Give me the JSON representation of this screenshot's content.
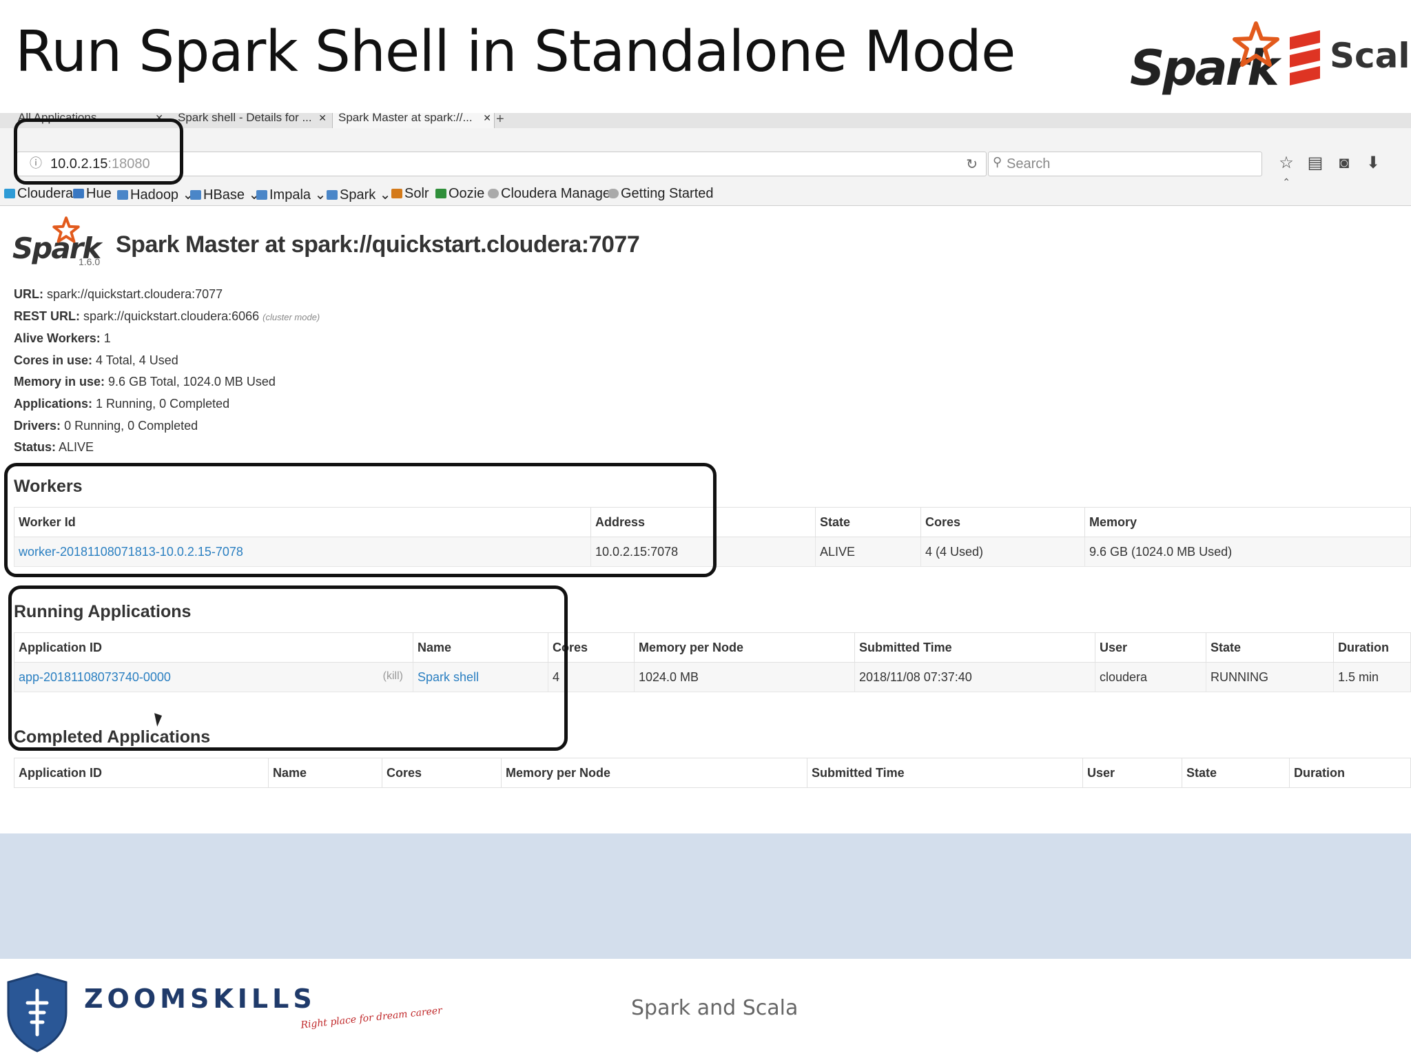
{
  "slide": {
    "title": "Run Spark Shell in Standalone Mode",
    "logos": {
      "spark": "Spark",
      "scala": "Scala"
    },
    "footer": {
      "brand": "ZOOMSKILLS",
      "tagline": "Right place for dream career",
      "center_text": "Spark and Scala"
    }
  },
  "browser": {
    "tabs": [
      {
        "label": "All Applications"
      },
      {
        "label": "Spark shell - Details for ..."
      },
      {
        "label": "Spark Master at spark://..."
      }
    ],
    "address": {
      "host": "10.0.2.15",
      "port": ":18080"
    },
    "search_placeholder": "Search",
    "bookmarks": [
      {
        "label": "Cloudera",
        "color": "#2e9bd6"
      },
      {
        "label": "Hue",
        "color": "#3a78c2"
      },
      {
        "label": "Hadoop",
        "color": "#4a86c8"
      },
      {
        "label": "HBase",
        "color": "#4a86c8"
      },
      {
        "label": "Impala",
        "color": "#4a86c8"
      },
      {
        "label": "Spark",
        "color": "#4a86c8"
      },
      {
        "label": "Solr",
        "color": "#d47a1a"
      },
      {
        "label": "Oozie",
        "color": "#2f8f3a"
      },
      {
        "label": "Cloudera Manager",
        "color": "#aaaaaa"
      },
      {
        "label": "Getting Started",
        "color": "#aaaaaa"
      }
    ]
  },
  "spark_ui": {
    "brand": "Spark",
    "version": "1.6.0",
    "heading": "Spark Master at spark://quickstart.cloudera:7077",
    "info": [
      {
        "key": "URL:",
        "value": "spark://quickstart.cloudera:7077",
        "note": ""
      },
      {
        "key": "REST URL:",
        "value": "spark://quickstart.cloudera:6066",
        "note": "(cluster mode)"
      },
      {
        "key": "Alive Workers:",
        "value": "1",
        "note": ""
      },
      {
        "key": "Cores in use:",
        "value": "4 Total, 4 Used",
        "note": ""
      },
      {
        "key": "Memory in use:",
        "value": "9.6 GB Total, 1024.0 MB Used",
        "note": ""
      },
      {
        "key": "Applications:",
        "value": "1 Running, 0 Completed",
        "note": ""
      },
      {
        "key": "Drivers:",
        "value": "0 Running, 0 Completed",
        "note": ""
      },
      {
        "key": "Status:",
        "value": "ALIVE",
        "note": ""
      }
    ],
    "workers": {
      "title": "Workers",
      "columns": [
        "Worker Id",
        "Address",
        "State",
        "Cores",
        "Memory"
      ],
      "rows": [
        [
          "worker-20181108071813-10.0.2.15-7078",
          "10.0.2.15:7078",
          "ALIVE",
          "4 (4 Used)",
          "9.6 GB (1024.0 MB Used)"
        ]
      ]
    },
    "running": {
      "title": "Running Applications",
      "columns": [
        "Application ID",
        "Name",
        "Cores",
        "Memory per Node",
        "Submitted Time",
        "User",
        "State",
        "Duration"
      ],
      "kill_label": "(kill)",
      "rows": [
        [
          "app-20181108073740-0000",
          "Spark shell",
          "4",
          "1024.0 MB",
          "2018/11/08 07:37:40",
          "cloudera",
          "RUNNING",
          "1.5 min"
        ]
      ]
    },
    "completed": {
      "title": "Completed Applications",
      "columns": [
        "Application ID",
        "Name",
        "Cores",
        "Memory per Node",
        "Submitted Time",
        "User",
        "State",
        "Duration"
      ]
    }
  },
  "colors": {
    "link": "#2a7fc1",
    "spark_star": "#e25a1c",
    "scala_red": "#de3423",
    "footer_blue": "#1f3a6a"
  }
}
